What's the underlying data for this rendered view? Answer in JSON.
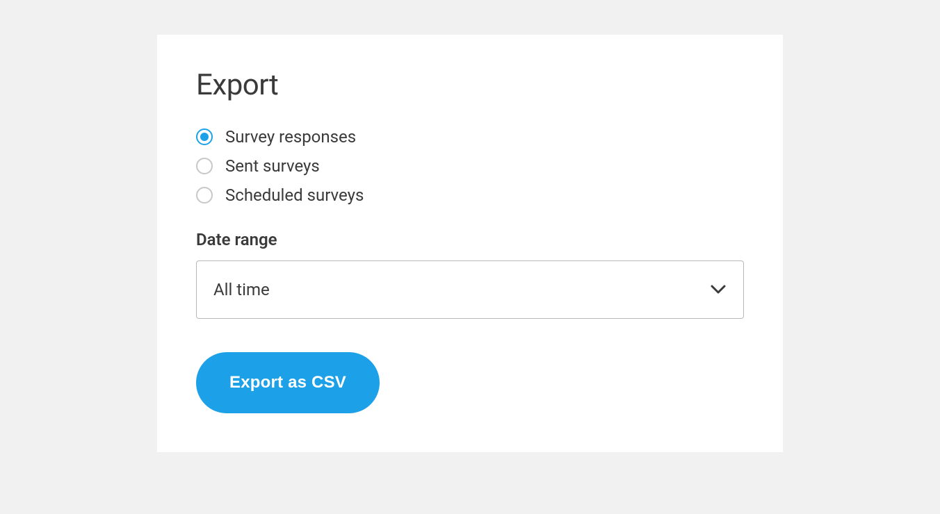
{
  "title": "Export",
  "radios": [
    {
      "label": "Survey responses",
      "selected": true
    },
    {
      "label": "Sent surveys",
      "selected": false
    },
    {
      "label": "Scheduled surveys",
      "selected": false
    }
  ],
  "date_range": {
    "label": "Date range",
    "value": "All time"
  },
  "button": {
    "label": "Export as CSV"
  },
  "colors": {
    "accent": "#1ca1e8",
    "text": "#3a3a3a",
    "border": "#b8b8b8",
    "bg": "#f1f1f1"
  }
}
